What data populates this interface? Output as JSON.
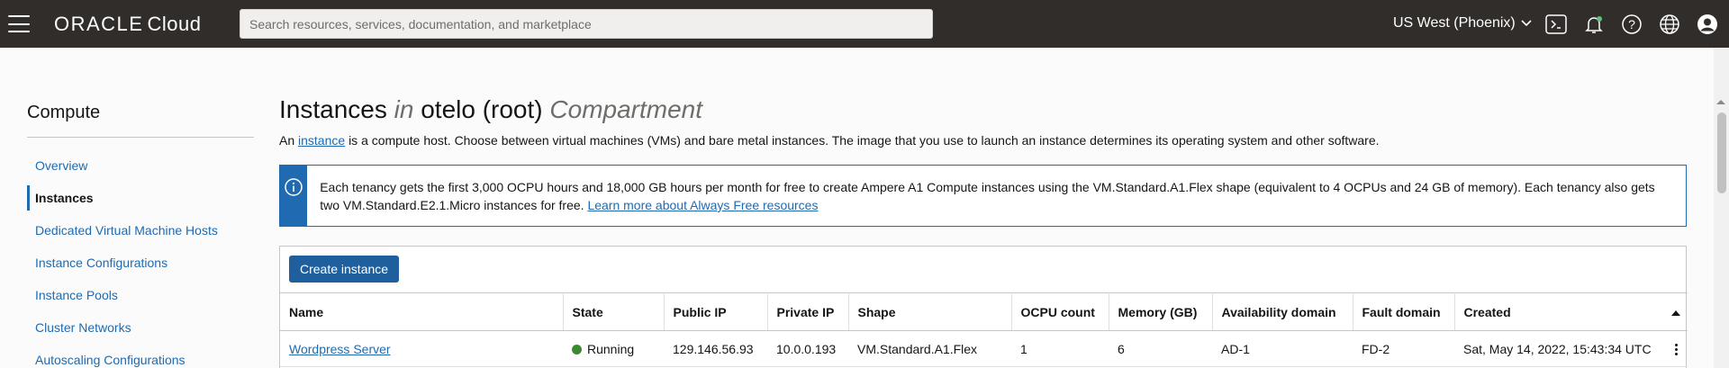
{
  "topbar": {
    "logo_brand": "ORACLE",
    "logo_product": "Cloud",
    "search_placeholder": "Search resources, services, documentation, and marketplace",
    "region": "US West (Phoenix)",
    "icons": [
      "menu-icon",
      "cloud-shell-icon",
      "notifications-bell-icon",
      "help-icon",
      "language-globe-icon",
      "user-profile-icon"
    ]
  },
  "sidebar": {
    "title": "Compute",
    "items": [
      {
        "label": "Overview",
        "active": false
      },
      {
        "label": "Instances",
        "active": true
      },
      {
        "label": "Dedicated Virtual Machine Hosts",
        "active": false
      },
      {
        "label": "Instance Configurations",
        "active": false
      },
      {
        "label": "Instance Pools",
        "active": false
      },
      {
        "label": "Cluster Networks",
        "active": false
      },
      {
        "label": "Autoscaling Configurations",
        "active": false
      }
    ]
  },
  "main": {
    "title_part1": "Instances",
    "title_in": "in",
    "title_compartment_name": "otelo (root)",
    "title_compartment_word": "Compartment",
    "desc_prefix": "An",
    "desc_link": "instance",
    "desc_rest": "is a compute host. Choose between virtual machines (VMs) and bare metal instances. The image that you use to launch an instance determines its operating system and other software.",
    "banner_text": "Each tenancy gets the first 3,000 OCPU hours and 18,000 GB hours per month for free to create Ampere A1 Compute instances using the VM.Standard.A1.Flex shape (equivalent to 4 OCPUs and 24 GB of memory). Each tenancy also gets two VM.Standard.E2.1.Micro instances for free.",
    "banner_link": "Learn more about Always Free resources",
    "create_button": "Create instance",
    "columns": [
      "Name",
      "State",
      "Public IP",
      "Private IP",
      "Shape",
      "OCPU count",
      "Memory (GB)",
      "Availability domain",
      "Fault domain",
      "Created"
    ],
    "rows": [
      {
        "name": "Wordpress Server",
        "state": "Running",
        "public_ip": "129.146.56.93",
        "private_ip": "10.0.0.193",
        "shape": "VM.Standard.A1.Flex",
        "ocpu": "1",
        "memory": "6",
        "ad": "AD-1",
        "fd": "FD-2",
        "created": "Sat, May 14, 2022, 15:43:34 UTC"
      }
    ],
    "colors": {
      "accent": "#1f6ab0",
      "running": "#3a8a2f",
      "topbar": "#312d2a"
    }
  }
}
